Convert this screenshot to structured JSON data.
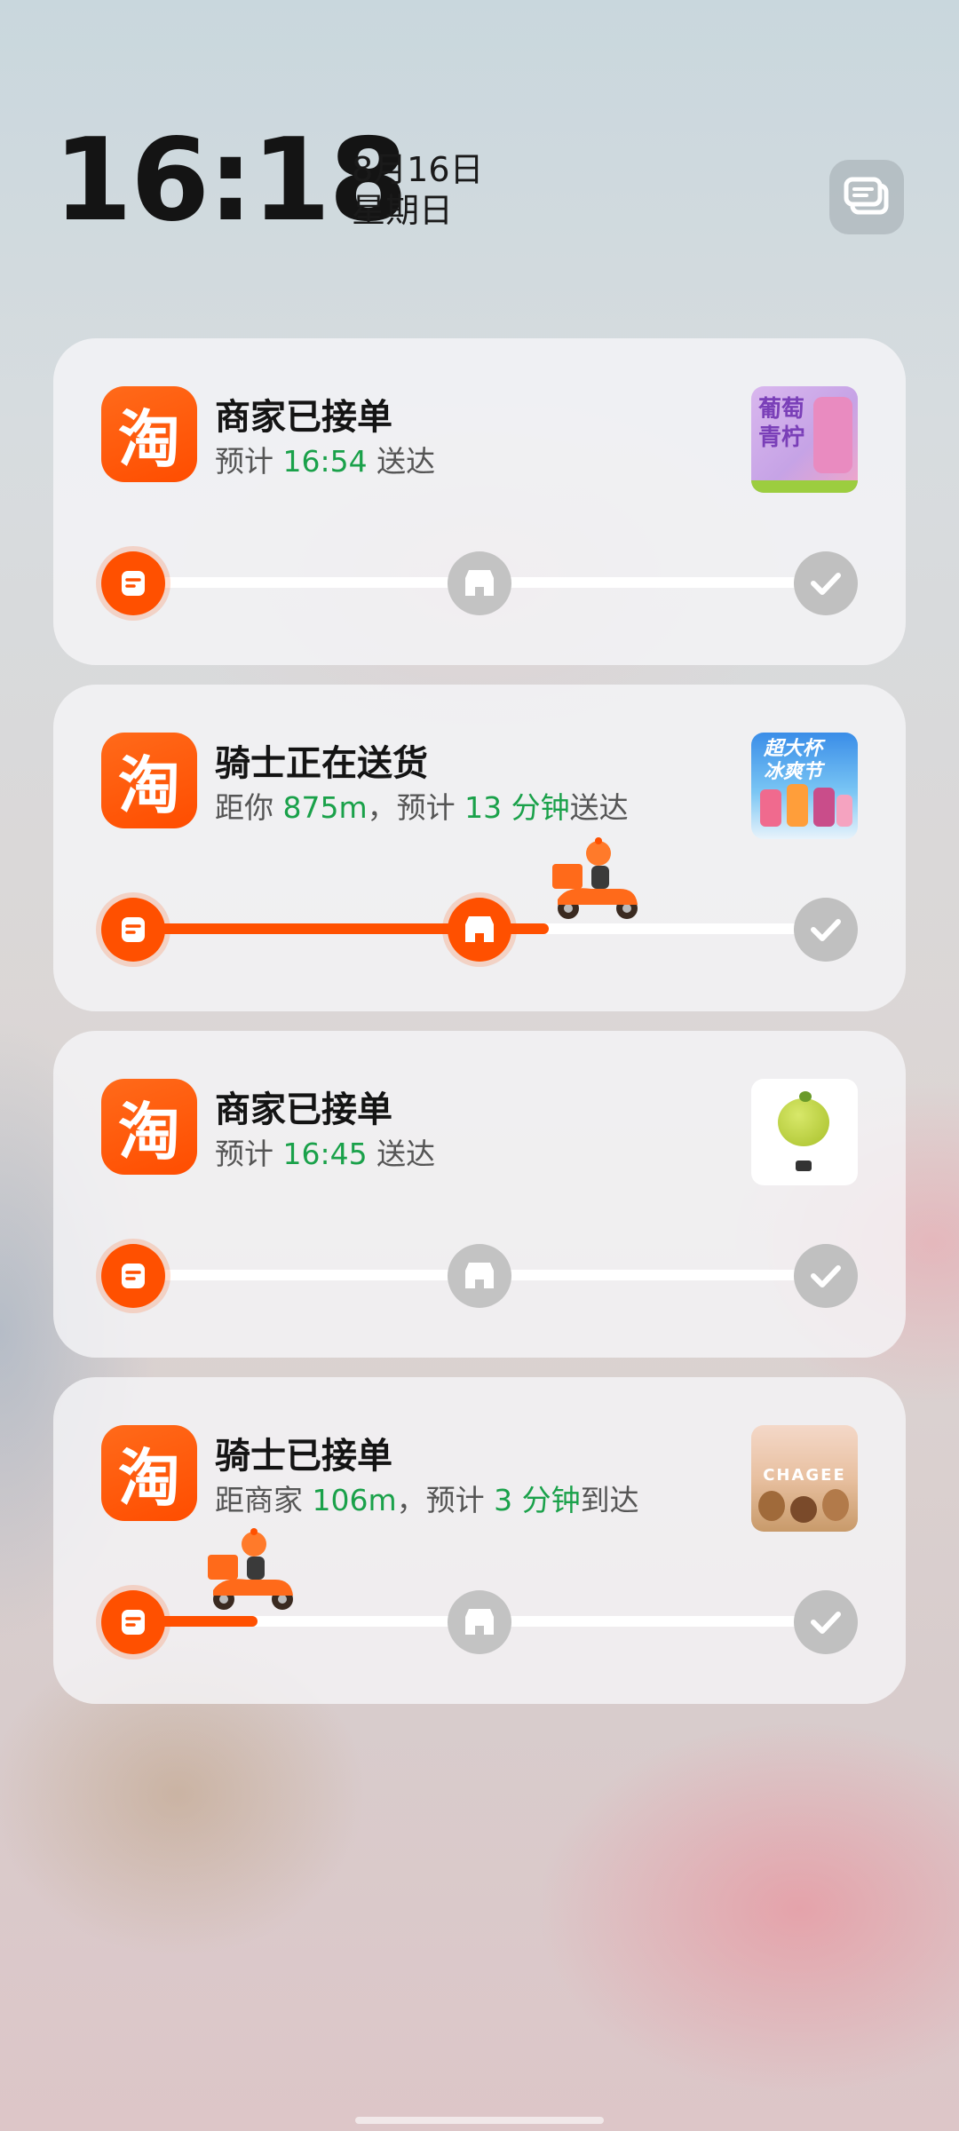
{
  "lockscreen": {
    "time": "16:18",
    "date": "8月16日",
    "weekday": "星期日"
  },
  "notifications": [
    {
      "app_icon_char": "淘",
      "title": "商家已接单",
      "subtitle": {
        "pre": "预计 ",
        "hl1": "16:54",
        "mid": " 送达",
        "hl2": "",
        "post": ""
      },
      "thumb_text": [
        "葡萄",
        "青柠"
      ],
      "progress": 0.0,
      "stage": "merchant-accepted"
    },
    {
      "app_icon_char": "淘",
      "title": "骑士正在送货",
      "subtitle": {
        "pre": "距你 ",
        "hl1": "875m",
        "mid": "，预计 ",
        "hl2": "13 分钟",
        "post": "送达"
      },
      "thumb_text": [
        "超大杯",
        "冰爽节"
      ],
      "progress": 0.5,
      "stage": "rider-delivering"
    },
    {
      "app_icon_char": "淘",
      "title": "商家已接单",
      "subtitle": {
        "pre": "预计 ",
        "hl1": "16:45",
        "mid": " 送达",
        "hl2": "",
        "post": ""
      },
      "thumb_text": [],
      "progress": 0.0,
      "stage": "merchant-accepted"
    },
    {
      "app_icon_char": "淘",
      "title": "骑士已接单",
      "subtitle": {
        "pre": "距商家 ",
        "hl1": "106m",
        "mid": "，预计 ",
        "hl2": "3 分钟",
        "post": "到达"
      },
      "thumb_text": [
        "CHAGEE"
      ],
      "progress": 0.18,
      "stage": "rider-accepted"
    }
  ],
  "colors": {
    "accent": "#ff5000",
    "highlight": "#1aa14a"
  },
  "icons": [
    "taobao-app-icon",
    "order-icon",
    "store-icon",
    "check-icon",
    "rider-scooter-icon",
    "notification-toggle-icon"
  ]
}
